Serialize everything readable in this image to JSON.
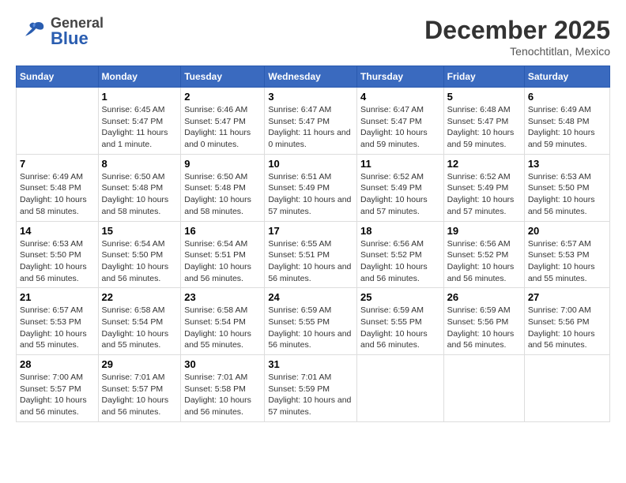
{
  "header": {
    "logo_general": "General",
    "logo_blue": "Blue",
    "month_title": "December 2025",
    "location": "Tenochtitlan, Mexico"
  },
  "days_of_week": [
    "Sunday",
    "Monday",
    "Tuesday",
    "Wednesday",
    "Thursday",
    "Friday",
    "Saturday"
  ],
  "weeks": [
    [
      {
        "day": "",
        "sunrise": "",
        "sunset": "",
        "daylight": ""
      },
      {
        "day": "1",
        "sunrise": "Sunrise: 6:45 AM",
        "sunset": "Sunset: 5:47 PM",
        "daylight": "Daylight: 11 hours and 1 minute."
      },
      {
        "day": "2",
        "sunrise": "Sunrise: 6:46 AM",
        "sunset": "Sunset: 5:47 PM",
        "daylight": "Daylight: 11 hours and 0 minutes."
      },
      {
        "day": "3",
        "sunrise": "Sunrise: 6:47 AM",
        "sunset": "Sunset: 5:47 PM",
        "daylight": "Daylight: 11 hours and 0 minutes."
      },
      {
        "day": "4",
        "sunrise": "Sunrise: 6:47 AM",
        "sunset": "Sunset: 5:47 PM",
        "daylight": "Daylight: 10 hours and 59 minutes."
      },
      {
        "day": "5",
        "sunrise": "Sunrise: 6:48 AM",
        "sunset": "Sunset: 5:47 PM",
        "daylight": "Daylight: 10 hours and 59 minutes."
      },
      {
        "day": "6",
        "sunrise": "Sunrise: 6:49 AM",
        "sunset": "Sunset: 5:48 PM",
        "daylight": "Daylight: 10 hours and 59 minutes."
      }
    ],
    [
      {
        "day": "7",
        "sunrise": "Sunrise: 6:49 AM",
        "sunset": "Sunset: 5:48 PM",
        "daylight": "Daylight: 10 hours and 58 minutes."
      },
      {
        "day": "8",
        "sunrise": "Sunrise: 6:50 AM",
        "sunset": "Sunset: 5:48 PM",
        "daylight": "Daylight: 10 hours and 58 minutes."
      },
      {
        "day": "9",
        "sunrise": "Sunrise: 6:50 AM",
        "sunset": "Sunset: 5:48 PM",
        "daylight": "Daylight: 10 hours and 58 minutes."
      },
      {
        "day": "10",
        "sunrise": "Sunrise: 6:51 AM",
        "sunset": "Sunset: 5:49 PM",
        "daylight": "Daylight: 10 hours and 57 minutes."
      },
      {
        "day": "11",
        "sunrise": "Sunrise: 6:52 AM",
        "sunset": "Sunset: 5:49 PM",
        "daylight": "Daylight: 10 hours and 57 minutes."
      },
      {
        "day": "12",
        "sunrise": "Sunrise: 6:52 AM",
        "sunset": "Sunset: 5:49 PM",
        "daylight": "Daylight: 10 hours and 57 minutes."
      },
      {
        "day": "13",
        "sunrise": "Sunrise: 6:53 AM",
        "sunset": "Sunset: 5:50 PM",
        "daylight": "Daylight: 10 hours and 56 minutes."
      }
    ],
    [
      {
        "day": "14",
        "sunrise": "Sunrise: 6:53 AM",
        "sunset": "Sunset: 5:50 PM",
        "daylight": "Daylight: 10 hours and 56 minutes."
      },
      {
        "day": "15",
        "sunrise": "Sunrise: 6:54 AM",
        "sunset": "Sunset: 5:50 PM",
        "daylight": "Daylight: 10 hours and 56 minutes."
      },
      {
        "day": "16",
        "sunrise": "Sunrise: 6:54 AM",
        "sunset": "Sunset: 5:51 PM",
        "daylight": "Daylight: 10 hours and 56 minutes."
      },
      {
        "day": "17",
        "sunrise": "Sunrise: 6:55 AM",
        "sunset": "Sunset: 5:51 PM",
        "daylight": "Daylight: 10 hours and 56 minutes."
      },
      {
        "day": "18",
        "sunrise": "Sunrise: 6:56 AM",
        "sunset": "Sunset: 5:52 PM",
        "daylight": "Daylight: 10 hours and 56 minutes."
      },
      {
        "day": "19",
        "sunrise": "Sunrise: 6:56 AM",
        "sunset": "Sunset: 5:52 PM",
        "daylight": "Daylight: 10 hours and 56 minutes."
      },
      {
        "day": "20",
        "sunrise": "Sunrise: 6:57 AM",
        "sunset": "Sunset: 5:53 PM",
        "daylight": "Daylight: 10 hours and 55 minutes."
      }
    ],
    [
      {
        "day": "21",
        "sunrise": "Sunrise: 6:57 AM",
        "sunset": "Sunset: 5:53 PM",
        "daylight": "Daylight: 10 hours and 55 minutes."
      },
      {
        "day": "22",
        "sunrise": "Sunrise: 6:58 AM",
        "sunset": "Sunset: 5:54 PM",
        "daylight": "Daylight: 10 hours and 55 minutes."
      },
      {
        "day": "23",
        "sunrise": "Sunrise: 6:58 AM",
        "sunset": "Sunset: 5:54 PM",
        "daylight": "Daylight: 10 hours and 55 minutes."
      },
      {
        "day": "24",
        "sunrise": "Sunrise: 6:59 AM",
        "sunset": "Sunset: 5:55 PM",
        "daylight": "Daylight: 10 hours and 56 minutes."
      },
      {
        "day": "25",
        "sunrise": "Sunrise: 6:59 AM",
        "sunset": "Sunset: 5:55 PM",
        "daylight": "Daylight: 10 hours and 56 minutes."
      },
      {
        "day": "26",
        "sunrise": "Sunrise: 6:59 AM",
        "sunset": "Sunset: 5:56 PM",
        "daylight": "Daylight: 10 hours and 56 minutes."
      },
      {
        "day": "27",
        "sunrise": "Sunrise: 7:00 AM",
        "sunset": "Sunset: 5:56 PM",
        "daylight": "Daylight: 10 hours and 56 minutes."
      }
    ],
    [
      {
        "day": "28",
        "sunrise": "Sunrise: 7:00 AM",
        "sunset": "Sunset: 5:57 PM",
        "daylight": "Daylight: 10 hours and 56 minutes."
      },
      {
        "day": "29",
        "sunrise": "Sunrise: 7:01 AM",
        "sunset": "Sunset: 5:57 PM",
        "daylight": "Daylight: 10 hours and 56 minutes."
      },
      {
        "day": "30",
        "sunrise": "Sunrise: 7:01 AM",
        "sunset": "Sunset: 5:58 PM",
        "daylight": "Daylight: 10 hours and 56 minutes."
      },
      {
        "day": "31",
        "sunrise": "Sunrise: 7:01 AM",
        "sunset": "Sunset: 5:59 PM",
        "daylight": "Daylight: 10 hours and 57 minutes."
      },
      {
        "day": "",
        "sunrise": "",
        "sunset": "",
        "daylight": ""
      },
      {
        "day": "",
        "sunrise": "",
        "sunset": "",
        "daylight": ""
      },
      {
        "day": "",
        "sunrise": "",
        "sunset": "",
        "daylight": ""
      }
    ]
  ]
}
